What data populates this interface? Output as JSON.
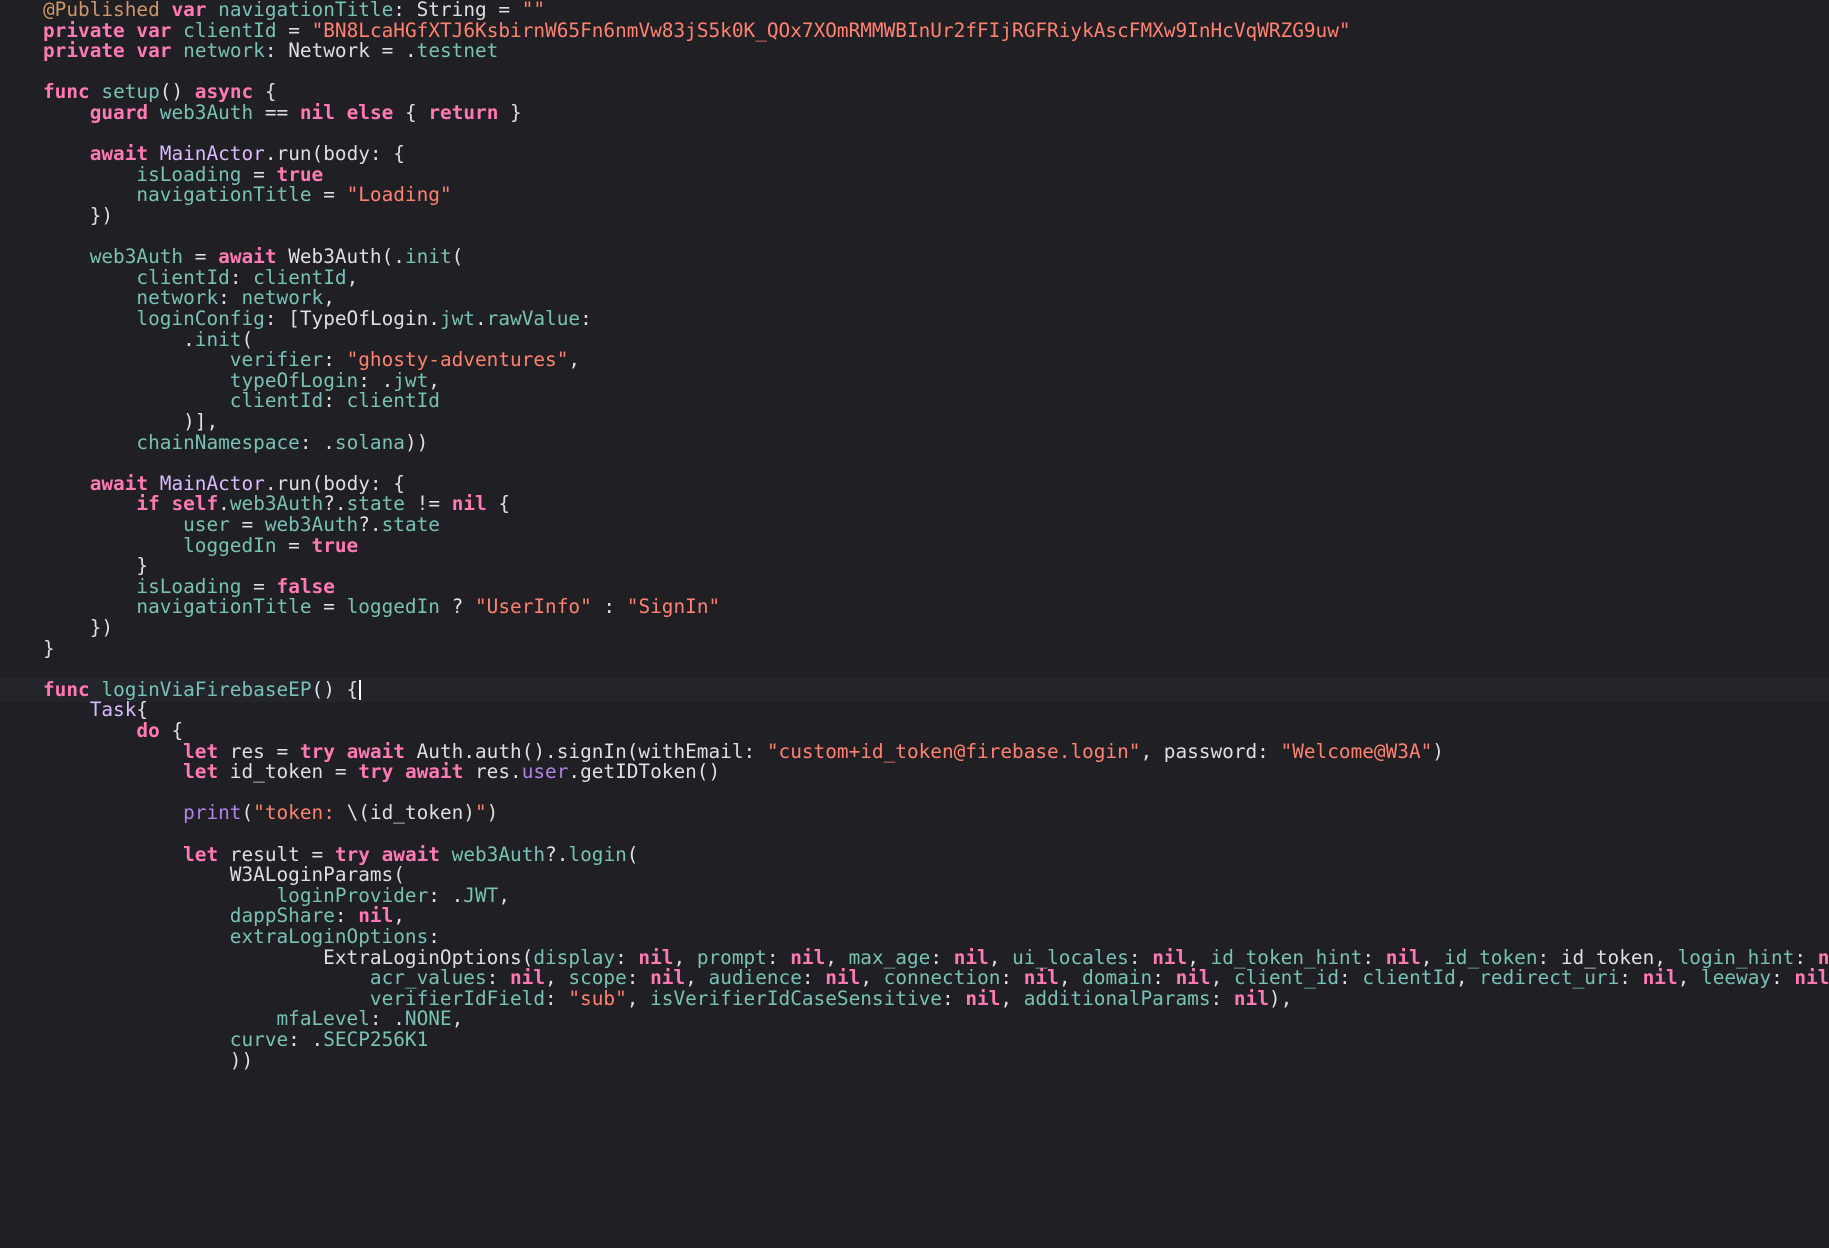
{
  "colors": {
    "background": "#1f1f24",
    "current_line": "#23252b",
    "keyword": "#ff7ab2",
    "string": "#ff8170",
    "identifier": "#78c2b3",
    "type": "#dabaff",
    "function": "#b281eb",
    "attribute": "#cc9768",
    "plain": "#dfdfe0"
  },
  "editor": {
    "current_line_index": 33,
    "lines": [
      [
        [
          "attr",
          "@Published"
        ],
        [
          "pl",
          " "
        ],
        [
          "kw",
          "var"
        ],
        [
          "pl",
          " "
        ],
        [
          "id",
          "navigationTitle"
        ],
        [
          "pl",
          ": String = "
        ],
        [
          "str",
          "\"\""
        ]
      ],
      [
        [
          "kw",
          "private"
        ],
        [
          "pl",
          " "
        ],
        [
          "kw",
          "var"
        ],
        [
          "pl",
          " "
        ],
        [
          "id",
          "clientId"
        ],
        [
          "pl",
          " = "
        ],
        [
          "str",
          "\"BN8LcaHGfXTJ6KsbirnW65Fn6nmVw83jS5k0K_QOx7XOmRMMWBInUr2fFIjRGFRiykAscFMXw9InHcVqWRZG9uw\""
        ]
      ],
      [
        [
          "kw",
          "private"
        ],
        [
          "pl",
          " "
        ],
        [
          "kw",
          "var"
        ],
        [
          "pl",
          " "
        ],
        [
          "id",
          "network"
        ],
        [
          "pl",
          ": Network = ."
        ],
        [
          "id",
          "testnet"
        ]
      ],
      [],
      [
        [
          "kw",
          "func"
        ],
        [
          "pl",
          " "
        ],
        [
          "id",
          "setup"
        ],
        [
          "pl",
          "() "
        ],
        [
          "kw",
          "async"
        ],
        [
          "pl",
          " {"
        ]
      ],
      [
        [
          "pl",
          "    "
        ],
        [
          "kw",
          "guard"
        ],
        [
          "pl",
          " "
        ],
        [
          "id",
          "web3Auth"
        ],
        [
          "pl",
          " == "
        ],
        [
          "kw",
          "nil"
        ],
        [
          "pl",
          " "
        ],
        [
          "kw",
          "else"
        ],
        [
          "pl",
          " { "
        ],
        [
          "kw",
          "return"
        ],
        [
          "pl",
          " }"
        ]
      ],
      [],
      [
        [
          "pl",
          "    "
        ],
        [
          "kw",
          "await"
        ],
        [
          "pl",
          " "
        ],
        [
          "ty",
          "MainActor"
        ],
        [
          "pl",
          ".run(body: {"
        ]
      ],
      [
        [
          "pl",
          "        "
        ],
        [
          "id",
          "isLoading"
        ],
        [
          "pl",
          " = "
        ],
        [
          "kw",
          "true"
        ]
      ],
      [
        [
          "pl",
          "        "
        ],
        [
          "id",
          "navigationTitle"
        ],
        [
          "pl",
          " = "
        ],
        [
          "str",
          "\"Loading\""
        ]
      ],
      [
        [
          "pl",
          "    })"
        ]
      ],
      [],
      [
        [
          "pl",
          "    "
        ],
        [
          "id",
          "web3Auth"
        ],
        [
          "pl",
          " = "
        ],
        [
          "kw",
          "await"
        ],
        [
          "pl",
          " Web3Auth(."
        ],
        [
          "id",
          "init"
        ],
        [
          "pl",
          "("
        ]
      ],
      [
        [
          "pl",
          "        "
        ],
        [
          "id",
          "clientId"
        ],
        [
          "pl",
          ": "
        ],
        [
          "id",
          "clientId"
        ],
        [
          "pl",
          ","
        ]
      ],
      [
        [
          "pl",
          "        "
        ],
        [
          "id",
          "network"
        ],
        [
          "pl",
          ": "
        ],
        [
          "id",
          "network"
        ],
        [
          "pl",
          ","
        ]
      ],
      [
        [
          "pl",
          "        "
        ],
        [
          "id",
          "loginConfig"
        ],
        [
          "pl",
          ": [TypeOfLogin."
        ],
        [
          "id",
          "jwt"
        ],
        [
          "pl",
          "."
        ],
        [
          "id",
          "rawValue"
        ],
        [
          "pl",
          ":"
        ]
      ],
      [
        [
          "pl",
          "            ."
        ],
        [
          "id",
          "init"
        ],
        [
          "pl",
          "("
        ]
      ],
      [
        [
          "pl",
          "                "
        ],
        [
          "id",
          "verifier"
        ],
        [
          "pl",
          ": "
        ],
        [
          "str",
          "\"ghosty-adventures\""
        ],
        [
          "pl",
          ","
        ]
      ],
      [
        [
          "pl",
          "                "
        ],
        [
          "id",
          "typeOfLogin"
        ],
        [
          "pl",
          ": ."
        ],
        [
          "id",
          "jwt"
        ],
        [
          "pl",
          ","
        ]
      ],
      [
        [
          "pl",
          "                "
        ],
        [
          "id",
          "clientId"
        ],
        [
          "pl",
          ": "
        ],
        [
          "id",
          "clientId"
        ]
      ],
      [
        [
          "pl",
          "            )],"
        ]
      ],
      [
        [
          "pl",
          "        "
        ],
        [
          "id",
          "chainNamespace"
        ],
        [
          "pl",
          ": ."
        ],
        [
          "id",
          "solana"
        ],
        [
          "pl",
          "))"
        ]
      ],
      [],
      [
        [
          "pl",
          "    "
        ],
        [
          "kw",
          "await"
        ],
        [
          "pl",
          " "
        ],
        [
          "ty",
          "MainActor"
        ],
        [
          "pl",
          ".run(body: {"
        ]
      ],
      [
        [
          "pl",
          "        "
        ],
        [
          "kw",
          "if"
        ],
        [
          "pl",
          " "
        ],
        [
          "kw",
          "self"
        ],
        [
          "pl",
          "."
        ],
        [
          "id",
          "web3Auth"
        ],
        [
          "pl",
          "?."
        ],
        [
          "id",
          "state"
        ],
        [
          "pl",
          " != "
        ],
        [
          "kw",
          "nil"
        ],
        [
          "pl",
          " {"
        ]
      ],
      [
        [
          "pl",
          "            "
        ],
        [
          "id",
          "user"
        ],
        [
          "pl",
          " = "
        ],
        [
          "id",
          "web3Auth"
        ],
        [
          "pl",
          "?."
        ],
        [
          "id",
          "state"
        ]
      ],
      [
        [
          "pl",
          "            "
        ],
        [
          "id",
          "loggedIn"
        ],
        [
          "pl",
          " = "
        ],
        [
          "kw",
          "true"
        ]
      ],
      [
        [
          "pl",
          "        }"
        ]
      ],
      [
        [
          "pl",
          "        "
        ],
        [
          "id",
          "isLoading"
        ],
        [
          "pl",
          " = "
        ],
        [
          "kw",
          "false"
        ]
      ],
      [
        [
          "pl",
          "        "
        ],
        [
          "id",
          "navigationTitle"
        ],
        [
          "pl",
          " = "
        ],
        [
          "id",
          "loggedIn"
        ],
        [
          "pl",
          " ? "
        ],
        [
          "str",
          "\"UserInfo\""
        ],
        [
          "pl",
          " : "
        ],
        [
          "str",
          "\"SignIn\""
        ]
      ],
      [
        [
          "pl",
          "    })"
        ]
      ],
      [
        [
          "pl",
          "}"
        ]
      ],
      [],
      [
        [
          "kw",
          "func"
        ],
        [
          "pl",
          " "
        ],
        [
          "id",
          "loginViaFirebaseEP"
        ],
        [
          "pl",
          "() {"
        ],
        [
          "caret",
          ""
        ]
      ],
      [
        [
          "pl",
          "    "
        ],
        [
          "ty",
          "Task"
        ],
        [
          "pl",
          "{"
        ]
      ],
      [
        [
          "pl",
          "        "
        ],
        [
          "kw",
          "do"
        ],
        [
          "pl",
          " {"
        ]
      ],
      [
        [
          "pl",
          "            "
        ],
        [
          "kw",
          "let"
        ],
        [
          "pl",
          " res = "
        ],
        [
          "kw",
          "try"
        ],
        [
          "pl",
          " "
        ],
        [
          "kw",
          "await"
        ],
        [
          "pl",
          " Auth.auth().signIn(withEmail: "
        ],
        [
          "str",
          "\"custom+id_token@firebase.login\""
        ],
        [
          "pl",
          ", password: "
        ],
        [
          "str",
          "\"Welcome@W3A\""
        ],
        [
          "pl",
          ")"
        ]
      ],
      [
        [
          "pl",
          "            "
        ],
        [
          "kw",
          "let"
        ],
        [
          "pl",
          " id_token = "
        ],
        [
          "kw",
          "try"
        ],
        [
          "pl",
          " "
        ],
        [
          "kw",
          "await"
        ],
        [
          "pl",
          " res."
        ],
        [
          "fn",
          "user"
        ],
        [
          "pl",
          ".getIDToken()"
        ]
      ],
      [],
      [
        [
          "pl",
          "            "
        ],
        [
          "fn",
          "print"
        ],
        [
          "pl",
          "("
        ],
        [
          "str",
          "\"token: "
        ],
        [
          "pl",
          "\\(id_token)"
        ],
        [
          "str",
          "\""
        ],
        [
          "pl",
          ")"
        ]
      ],
      [],
      [
        [
          "pl",
          "            "
        ],
        [
          "kw",
          "let"
        ],
        [
          "pl",
          " result = "
        ],
        [
          "kw",
          "try"
        ],
        [
          "pl",
          " "
        ],
        [
          "kw",
          "await"
        ],
        [
          "pl",
          " "
        ],
        [
          "id",
          "web3Auth"
        ],
        [
          "pl",
          "?."
        ],
        [
          "id",
          "login"
        ],
        [
          "pl",
          "("
        ]
      ],
      [
        [
          "pl",
          "                W3ALoginParams("
        ]
      ],
      [
        [
          "pl",
          "                    "
        ],
        [
          "id",
          "loginProvider"
        ],
        [
          "pl",
          ": ."
        ],
        [
          "id",
          "JWT"
        ],
        [
          "pl",
          ","
        ]
      ],
      [
        [
          "pl",
          "                "
        ],
        [
          "id",
          "dappShare"
        ],
        [
          "pl",
          ": "
        ],
        [
          "kw",
          "nil"
        ],
        [
          "pl",
          ","
        ]
      ],
      [
        [
          "pl",
          "                "
        ],
        [
          "id",
          "extraLoginOptions"
        ],
        [
          "pl",
          ":"
        ]
      ],
      [
        [
          "pl",
          "                        ExtraLoginOptions("
        ],
        [
          "id",
          "display"
        ],
        [
          "pl",
          ": "
        ],
        [
          "kw",
          "nil"
        ],
        [
          "pl",
          ", "
        ],
        [
          "id",
          "prompt"
        ],
        [
          "pl",
          ": "
        ],
        [
          "kw",
          "nil"
        ],
        [
          "pl",
          ", "
        ],
        [
          "id",
          "max_age"
        ],
        [
          "pl",
          ": "
        ],
        [
          "kw",
          "nil"
        ],
        [
          "pl",
          ", "
        ],
        [
          "id",
          "ui_locales"
        ],
        [
          "pl",
          ": "
        ],
        [
          "kw",
          "nil"
        ],
        [
          "pl",
          ", "
        ],
        [
          "id",
          "id_token_hint"
        ],
        [
          "pl",
          ": "
        ],
        [
          "kw",
          "nil"
        ],
        [
          "pl",
          ", "
        ],
        [
          "id",
          "id_token"
        ],
        [
          "pl",
          ": id_token, "
        ],
        [
          "id",
          "login_hint"
        ],
        [
          "pl",
          ": "
        ],
        [
          "kw",
          "nil"
        ],
        [
          "pl",
          ","
        ]
      ],
      [
        [
          "pl",
          "                            "
        ],
        [
          "id",
          "acr_values"
        ],
        [
          "pl",
          ": "
        ],
        [
          "kw",
          "nil"
        ],
        [
          "pl",
          ", "
        ],
        [
          "id",
          "scope"
        ],
        [
          "pl",
          ": "
        ],
        [
          "kw",
          "nil"
        ],
        [
          "pl",
          ", "
        ],
        [
          "id",
          "audience"
        ],
        [
          "pl",
          ": "
        ],
        [
          "kw",
          "nil"
        ],
        [
          "pl",
          ", "
        ],
        [
          "id",
          "connection"
        ],
        [
          "pl",
          ": "
        ],
        [
          "kw",
          "nil"
        ],
        [
          "pl",
          ", "
        ],
        [
          "id",
          "domain"
        ],
        [
          "pl",
          ": "
        ],
        [
          "kw",
          "nil"
        ],
        [
          "pl",
          ", "
        ],
        [
          "id",
          "client_id"
        ],
        [
          "pl",
          ": "
        ],
        [
          "id",
          "clientId"
        ],
        [
          "pl",
          ", "
        ],
        [
          "id",
          "redirect_uri"
        ],
        [
          "pl",
          ": "
        ],
        [
          "kw",
          "nil"
        ],
        [
          "pl",
          ", "
        ],
        [
          "id",
          "leeway"
        ],
        [
          "pl",
          ": "
        ],
        [
          "kw",
          "nil"
        ],
        [
          "pl",
          ","
        ]
      ],
      [
        [
          "pl",
          "                            "
        ],
        [
          "id",
          "verifierIdField"
        ],
        [
          "pl",
          ": "
        ],
        [
          "str",
          "\"sub\""
        ],
        [
          "pl",
          ", "
        ],
        [
          "id",
          "isVerifierIdCaseSensitive"
        ],
        [
          "pl",
          ": "
        ],
        [
          "kw",
          "nil"
        ],
        [
          "pl",
          ", "
        ],
        [
          "id",
          "additionalParams"
        ],
        [
          "pl",
          ": "
        ],
        [
          "kw",
          "nil"
        ],
        [
          "pl",
          "),"
        ]
      ],
      [
        [
          "pl",
          "                    "
        ],
        [
          "id",
          "mfaLevel"
        ],
        [
          "pl",
          ": ."
        ],
        [
          "id",
          "NONE"
        ],
        [
          "pl",
          ","
        ]
      ],
      [
        [
          "pl",
          "                "
        ],
        [
          "id",
          "curve"
        ],
        [
          "pl",
          ": ."
        ],
        [
          "id",
          "SECP256K1"
        ]
      ],
      [
        [
          "pl",
          "                ))"
        ]
      ]
    ]
  }
}
